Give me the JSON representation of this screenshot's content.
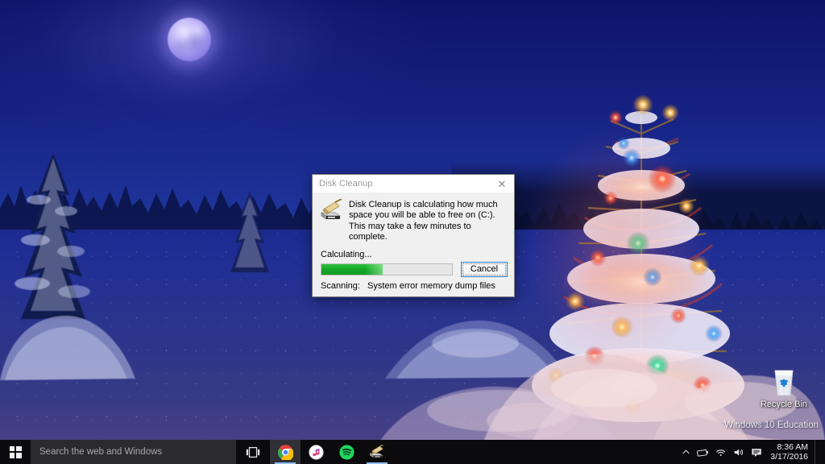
{
  "desktop": {
    "icons": [
      {
        "name": "recycle-bin",
        "label": "Recycle Bin"
      }
    ],
    "watermark": "Windows 10 Education"
  },
  "dialog": {
    "title": "Disk Cleanup",
    "close_label": "✕",
    "icon_name": "disk-cleanup-icon",
    "message": "Disk Cleanup is calculating how much space you will be able to free on  (C:). This may take a few minutes to complete.",
    "calculating_label": "Calculating...",
    "progress_percent": 47,
    "cancel_label": "Cancel",
    "scanning_label": "Scanning:",
    "scanning_target": "System error memory dump files"
  },
  "taskbar": {
    "start_label": "Start",
    "search": {
      "placeholder": "Search the web and Windows",
      "value": ""
    },
    "task_view_label": "Task View",
    "apps": [
      {
        "name": "google-chrome",
        "label": "Google Chrome",
        "running": true,
        "active": true
      },
      {
        "name": "itunes",
        "label": "iTunes",
        "running": false,
        "active": false
      },
      {
        "name": "spotify",
        "label": "Spotify",
        "running": false,
        "active": false
      },
      {
        "name": "disk-cleanup",
        "label": "Disk Cleanup",
        "running": true,
        "active": false
      }
    ],
    "tray": {
      "show_hidden_label": "∧",
      "battery_label": "Battery",
      "network_label": "Network",
      "volume_label": "Volume",
      "action_center_label": "Action Center"
    },
    "clock": {
      "time": "8:36 AM",
      "date": "3/17/2016"
    }
  },
  "colors": {
    "sky_top": "#0c1468",
    "sky_bottom": "#24419f",
    "snow_bottom": "#4d4285",
    "progress_green": "#16a828",
    "accent_blue": "#2a7fd4",
    "taskbar": "#0b0b0d"
  }
}
